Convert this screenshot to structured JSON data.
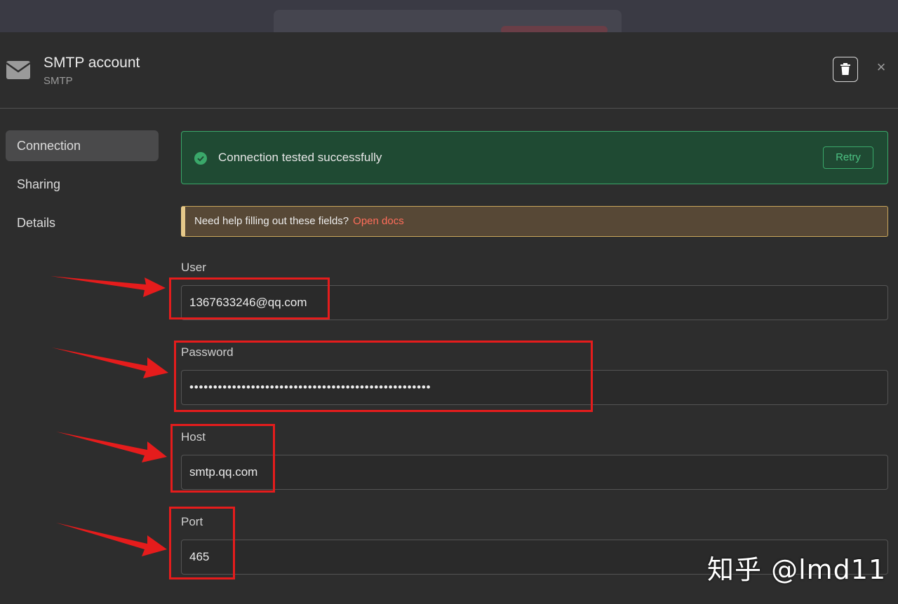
{
  "header": {
    "title": "SMTP account",
    "subtitle": "SMTP"
  },
  "sidebar": {
    "items": [
      {
        "label": "Connection",
        "active": true
      },
      {
        "label": "Sharing",
        "active": false
      },
      {
        "label": "Details",
        "active": false
      }
    ]
  },
  "status": {
    "message": "Connection tested successfully",
    "retry_label": "Retry"
  },
  "help": {
    "text": "Need help filling out these fields?",
    "link": "Open docs"
  },
  "fields": {
    "user": {
      "label": "User",
      "value": "1367633246@qq.com"
    },
    "password": {
      "label": "Password",
      "value": "•••••••••••••••••••••••••••••••••••••••••••••••••••"
    },
    "host": {
      "label": "Host",
      "value": "smtp.qq.com"
    },
    "port": {
      "label": "Port",
      "value": "465"
    }
  },
  "watermark": "知乎 @lmd11",
  "colors": {
    "success": "#3aa86a",
    "link": "#ff6d5a",
    "annotation": "#e51c1c"
  }
}
